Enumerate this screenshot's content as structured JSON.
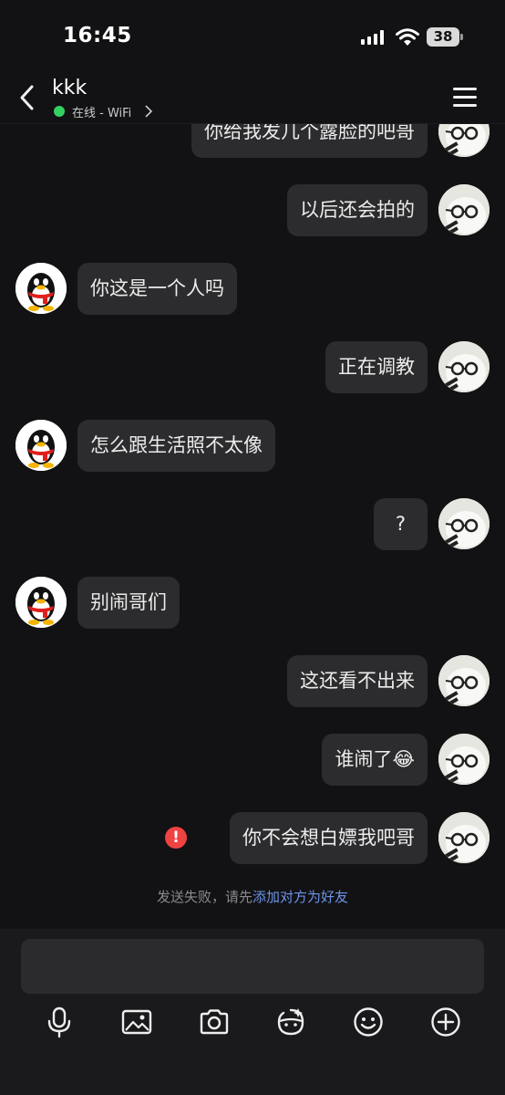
{
  "status_bar": {
    "time": "16:45",
    "battery": "38"
  },
  "header": {
    "name": "kkk",
    "status": "在线 - WiFi"
  },
  "messages": [
    {
      "side": "out",
      "text": "你给我发几个露脸的吧哥"
    },
    {
      "side": "out",
      "text": "以后还会拍的"
    },
    {
      "side": "in",
      "text": "你这是一个人吗"
    },
    {
      "side": "out",
      "text": "正在调教"
    },
    {
      "side": "in",
      "text": "怎么跟生活照不太像"
    },
    {
      "side": "out",
      "text": "?"
    },
    {
      "side": "in",
      "text": "别闹哥们"
    },
    {
      "side": "out",
      "text": "这还看不出来"
    },
    {
      "side": "out",
      "text": "谁闹了",
      "emoji": "😂"
    },
    {
      "side": "out",
      "text": "你不会想白嫖我吧哥",
      "failed": true
    }
  ],
  "system_notice": {
    "prefix": "发送失败，请先",
    "link": "添加对方为好友"
  },
  "composer": {
    "input_value": ""
  },
  "toolbar": [
    "microphone-icon",
    "image-icon",
    "camera-icon",
    "sticker-icon",
    "emoji-icon",
    "plus-icon"
  ],
  "colors": {
    "background": "#121214",
    "bubble": "#2c2c2e",
    "online": "#35d062",
    "error": "#ef4242",
    "link": "#6e93e8"
  }
}
